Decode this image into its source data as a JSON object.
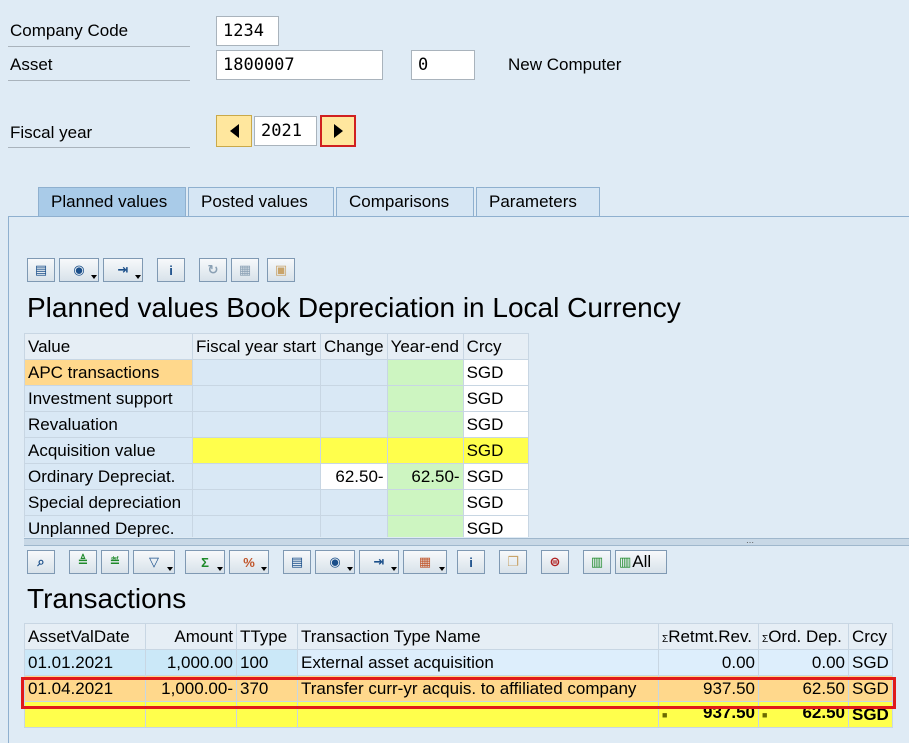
{
  "header": {
    "company_code_label": "Company Code",
    "company_code_value": "1234",
    "asset_label": "Asset",
    "asset_value": "1800007",
    "asset_sub_value": "0",
    "asset_description": "New Computer",
    "fiscal_year_label": "Fiscal year",
    "fiscal_year_value": "2021"
  },
  "tabs": [
    {
      "label": "Planned values",
      "active": true
    },
    {
      "label": "Posted values",
      "active": false
    },
    {
      "label": "Comparisons",
      "active": false
    },
    {
      "label": "Parameters",
      "active": false
    }
  ],
  "planned": {
    "title": "Planned values Book Depreciation in Local Currency",
    "columns": [
      "Value",
      "Fiscal year start",
      "Change",
      "Year-end",
      "Crcy"
    ],
    "rows": [
      {
        "value": "APC transactions",
        "fy_start": "",
        "change": "",
        "year_end": "",
        "crcy": "SGD"
      },
      {
        "value": "Investment support",
        "fy_start": "",
        "change": "",
        "year_end": "",
        "crcy": "SGD"
      },
      {
        "value": "Revaluation",
        "fy_start": "",
        "change": "",
        "year_end": "",
        "crcy": "SGD"
      },
      {
        "value": "Acquisition value",
        "fy_start": "",
        "change": "",
        "year_end": "",
        "crcy": "SGD"
      },
      {
        "value": "Ordinary Depreciat.",
        "fy_start": "",
        "change": "62.50-",
        "year_end": "62.50-",
        "crcy": "SGD"
      },
      {
        "value": "Special depreciation",
        "fy_start": "",
        "change": "",
        "year_end": "",
        "crcy": "SGD"
      },
      {
        "value": "Unplanned Deprec.",
        "fy_start": "",
        "change": "",
        "year_end": "",
        "crcy": "SGD"
      }
    ]
  },
  "transactions": {
    "title": "Transactions",
    "all_label": "All",
    "columns": [
      "AssetValDate",
      "Amount",
      "TType",
      "Transaction Type Name",
      "Retmt.Rev.",
      "Ord. Dep.",
      "Crcy"
    ],
    "rows": [
      {
        "date": "01.01.2021",
        "amount": "1,000.00",
        "ttype": "100",
        "name": "External asset acquisition",
        "retmt": "0.00",
        "orddep": "0.00",
        "crcy": "SGD"
      },
      {
        "date": "01.04.2021",
        "amount": "1,000.00-",
        "ttype": "370",
        "name": "Transfer curr-yr acquis. to affiliated company",
        "retmt": "937.50",
        "orddep": "62.50",
        "crcy": "SGD"
      }
    ],
    "totals": {
      "retmt": "937.50",
      "orddep": "62.50",
      "crcy": "SGD"
    }
  },
  "colors": {
    "highlight_border": "#e01a1a",
    "total_row": "#ffff4c",
    "selected_row": "#ffd88c"
  }
}
